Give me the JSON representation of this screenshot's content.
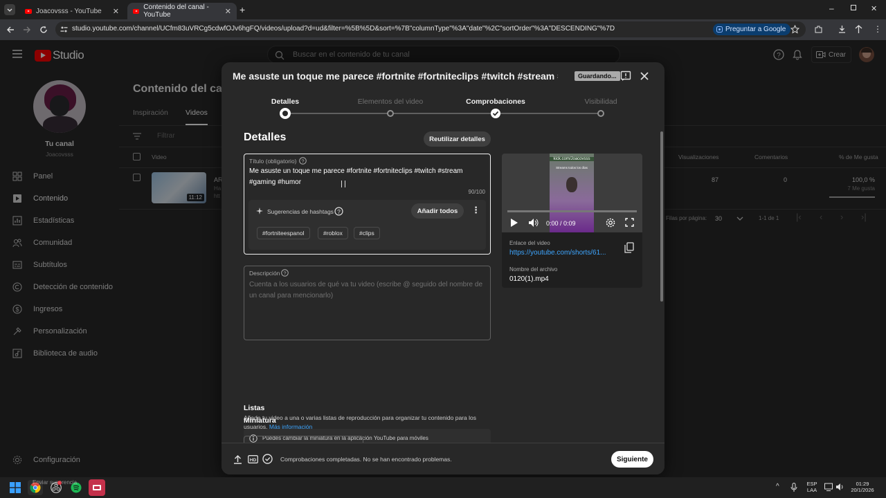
{
  "browser": {
    "tabs": [
      {
        "title": "Joacovsss - YouTube",
        "active": false
      },
      {
        "title": "Contenido del canal - YouTube",
        "active": true
      }
    ],
    "url": "studio.youtube.com/channel/UCfm83uVRCg5cdwfOJv6hgFQ/videos/upload?d=ud&filter=%5B%5D&sort=%7B\"columnType\"%3A\"date\"%2C\"sortOrder\"%3A\"DESCENDING\"%7D",
    "google_button": "Preguntar a Google"
  },
  "studio": {
    "logo_text": "Studio",
    "search_placeholder": "Buscar en el contenido de tu canal",
    "create_label": "Crear"
  },
  "sidebar": {
    "channel_label": "Tu canal",
    "channel_name": "Joacovsss",
    "items": [
      {
        "label": "Panel",
        "icon": "dashboard-icon"
      },
      {
        "label": "Contenido",
        "icon": "content-icon"
      },
      {
        "label": "Estadísticas",
        "icon": "analytics-icon"
      },
      {
        "label": "Comunidad",
        "icon": "community-icon"
      },
      {
        "label": "Subtítulos",
        "icon": "subtitles-icon"
      },
      {
        "label": "Detección de contenido",
        "icon": "copyright-icon"
      },
      {
        "label": "Ingresos",
        "icon": "earn-icon"
      },
      {
        "label": "Personalización",
        "icon": "customization-icon"
      },
      {
        "label": "Biblioteca de audio",
        "icon": "audio-library-icon"
      }
    ],
    "settings_label": "Configuración",
    "feedback_label": "Enviar sugerencia"
  },
  "content_page": {
    "title": "Contenido del canal",
    "tabs": [
      "Inspiración",
      "Videos"
    ],
    "filter_placeholder": "Filtrar",
    "video_column": "Video",
    "video_title_snippet": "AR",
    "video_line2": "Ha",
    "video_line3": "htt",
    "duration": "11:12",
    "columns": {
      "views": "Visualizaciones",
      "comments": "Comentarios",
      "likes": "% de Me gusta"
    },
    "row": {
      "views": "87",
      "comments": "0",
      "likes_pct": "100,0 %",
      "likes_count": "7 Me gusta"
    },
    "pagination": {
      "rows_label": "Filas por página:",
      "rows_value": "30",
      "range": "1-1 de 1"
    }
  },
  "dialog": {
    "title": "Me asuste un toque me parece #fortnite #fortniteclips #twitch #stream #...",
    "saving_badge": "Guardando...",
    "steps": [
      {
        "label": "Detalles",
        "state": "current"
      },
      {
        "label": "Elementos del video",
        "state": "pending"
      },
      {
        "label": "Comprobaciones",
        "state": "done"
      },
      {
        "label": "Visibilidad",
        "state": "pending"
      }
    ],
    "section_title": "Detalles",
    "reuse_button": "Reutilizar detalles",
    "title_field": {
      "label": "Título (obligatorio)",
      "value_line1": "Me asuste un toque me parece  #fortnite #fortniteclips  #twitch  #stream",
      "value_line2": "#gaming  #humor",
      "counter": "90/100"
    },
    "hashtags": {
      "label": "Sugerencias de hashtags",
      "add_all": "Añadir todos",
      "chips": [
        "#fortniteespanol",
        "#roblox",
        "#clips"
      ]
    },
    "description_field": {
      "label": "Descripción",
      "placeholder": "Cuenta a los usuarios de qué va tu video (escribe @ seguido del nombre de un canal para mencionarlo)"
    },
    "thumbnail": {
      "heading": "Miniatura",
      "info": "Puedes cambiar la miniatura en la aplicación YouTube para móviles"
    },
    "playlists": {
      "heading": "Listas",
      "text": "Añade tu video a una o varias listas de reproducción para organizar tu contenido para los usuarios.",
      "link": "Más información"
    },
    "preview": {
      "overlay_title": "kick.com/Joacovsss",
      "overlay_sub": "Streams todos los días",
      "time": "0:00 / 0:09",
      "link_label": "Enlace del video",
      "link": "https://youtube.com/shorts/61...",
      "file_label": "Nombre del archivo",
      "file_name": "0120(1).mp4"
    },
    "footer": {
      "status": "Comprobaciones completadas. No se han encontrado problemas.",
      "next_button": "Siguiente"
    }
  },
  "taskbar": {
    "lang1": "ESP",
    "lang2": "LAA",
    "time": "01:29",
    "date": "20/1/2026"
  },
  "colors": {
    "accent_red": "#ff0000",
    "link_blue": "#3ea6ff",
    "bg": "#282828"
  }
}
